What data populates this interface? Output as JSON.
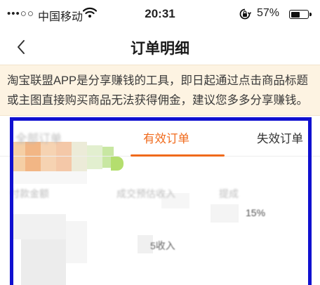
{
  "status_bar": {
    "signal": "•••○○",
    "carrier": "中国移动",
    "wifi_icon": "wifi-icon",
    "time": "20:31",
    "lock_icon": "orientation-lock-icon",
    "battery_percent": "57%",
    "battery_level": 0.57
  },
  "nav": {
    "back_icon": "chevron-left-icon",
    "title": "订单明细"
  },
  "notice": {
    "line1": "淘宝联盟APP是分享赚钱的工具，即日起通过点击商品标题",
    "line2": "或主图直接购买商品无法获得佣金，建议您多多分享赚钱。",
    "background": "#fdf3e2"
  },
  "tabs": {
    "all": "全部订单",
    "valid": "有效订单",
    "invalid": "失效订单",
    "active_color": "#f06a1b"
  },
  "order": {
    "col_payment": "付款金额",
    "col_estimate": "成交预估收入",
    "col_commission": "提成",
    "commission_pct": "15%",
    "income_label": "5收入"
  },
  "annotation_color": "#1010d0"
}
